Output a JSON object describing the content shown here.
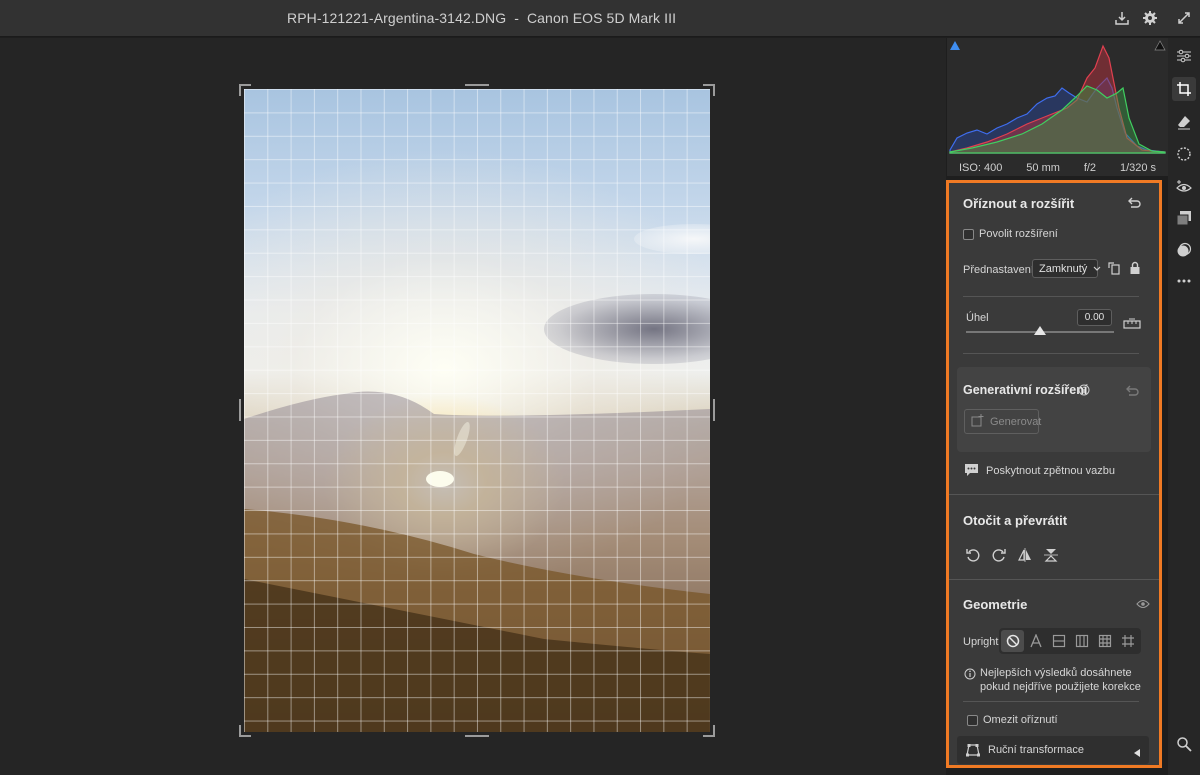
{
  "window": {
    "title": "RPH-121221-Argentina-3142.DNG  -  Canon EOS 5D Mark III"
  },
  "exif": {
    "iso": "ISO: 400",
    "focal": "50 mm",
    "aperture": "f/2",
    "shutter": "1/320 s"
  },
  "crop": {
    "title": "Oříznout a rozšířit",
    "allow_expand_label": "Povolit rozšíření",
    "preset_label": "Přednastavení",
    "preset_value": "Zamknutý",
    "angle_label": "Úhel",
    "angle_value": "0.00",
    "angle_slider_fraction": 0.5
  },
  "generative": {
    "title": "Generativní rozšíření",
    "generate_label": "Generovat",
    "feedback_label": "Poskytnout zpětnou vazbu"
  },
  "rotate": {
    "title": "Otočit a převrátit"
  },
  "geometry": {
    "title": "Geometrie",
    "upright_label": "Upright",
    "upright_options": [
      "off",
      "auto",
      "level",
      "vertical",
      "full",
      "guided"
    ],
    "info_line1": "Nejlepších výsledků dosáhnete",
    "info_line2": "pokud nejdříve použijete korekce",
    "constrain_label": "Omezit oříznutí",
    "manual_label": "Ruční transformace"
  },
  "colors": {
    "accent": "#f07a24",
    "panel": "#3a3a3a",
    "canvas": "#252525"
  },
  "toolbar": {
    "tools": [
      "edit-sliders-icon",
      "crop-icon",
      "eraser-icon",
      "mask-icon",
      "redeye-icon",
      "presets-icon",
      "snapshots-icon",
      "more-icon",
      "zoom-icon"
    ]
  }
}
